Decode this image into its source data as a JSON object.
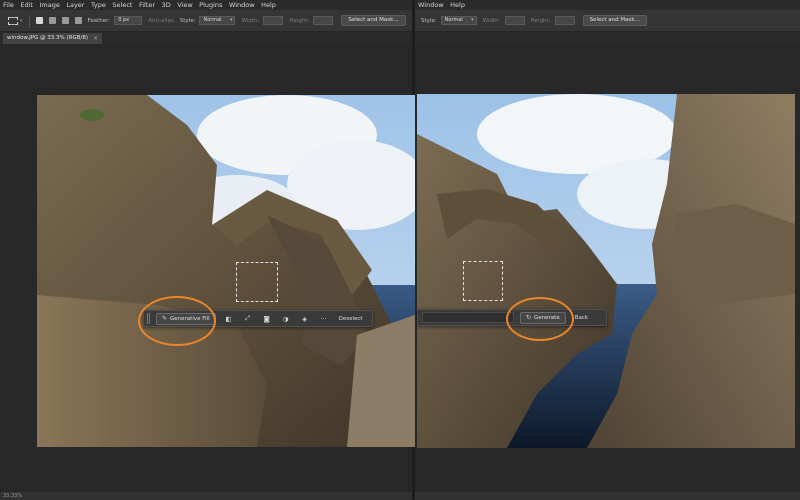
{
  "menu_left": [
    "File",
    "Edit",
    "Image",
    "Layer",
    "Type",
    "Select",
    "Filter",
    "3D",
    "View",
    "Plugins",
    "Window",
    "Help"
  ],
  "menu_right": [
    "Window",
    "Help"
  ],
  "options": {
    "feather_label": "Feather:",
    "feather_value": "0 px",
    "antialias_label": "Anti-alias",
    "style_label": "Style:",
    "style_value": "Normal",
    "width_label": "Width:",
    "height_label": "Height:",
    "select_mask_label": "Select and Mask..."
  },
  "document_tab": {
    "title": "window.JPG @ 33.3% (RGB/8)",
    "close": "×"
  },
  "status": {
    "zoom": "33.33%"
  },
  "taskbar_left": {
    "generative_fill_label": "Generative Fill",
    "deselect_label": "Deselect",
    "more": "···"
  },
  "taskbar_right": {
    "generate_label": "Generate",
    "back_label": "Back"
  },
  "colors": {
    "accent_callout": "#e8862c",
    "ui_bg": "#282828",
    "panel_bg": "#353535"
  },
  "icons": {
    "generative_fill": "sparkle-brush-icon",
    "generate": "sparkle-loop-icon"
  }
}
